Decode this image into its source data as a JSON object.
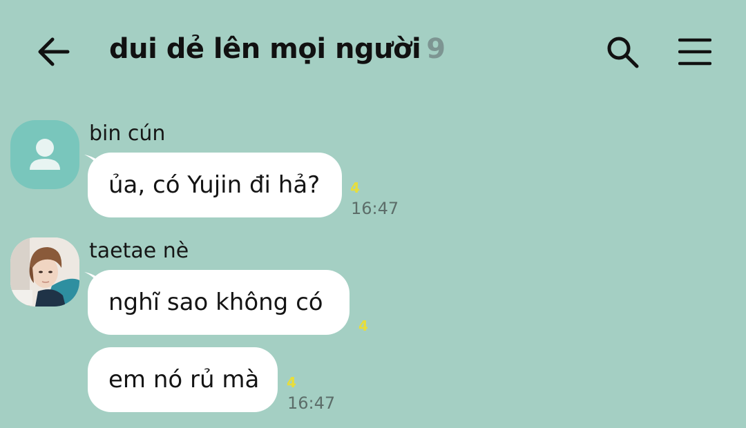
{
  "header": {
    "title": "dui dẻ lên mọi người",
    "member_count": "9",
    "back_icon": "arrow-left-icon",
    "search_icon": "search-icon",
    "menu_icon": "hamburger-menu-icon"
  },
  "messages": [
    {
      "sender": "bin cún",
      "avatar": "default-person-icon",
      "text": "ủa, có Yujin đi hả?",
      "unread": "4",
      "time": "16:47"
    },
    {
      "sender": "taetae nè",
      "avatar": "profile-photo",
      "text": "nghĩ sao không có",
      "unread": "4"
    },
    {
      "text": "em nó rủ mà",
      "unread": "4",
      "time": "16:47"
    }
  ],
  "colors": {
    "background": "#a4cfc3",
    "bubble": "#ffffff",
    "unread": "#e8de3a",
    "default_avatar": "#79c6bc"
  }
}
